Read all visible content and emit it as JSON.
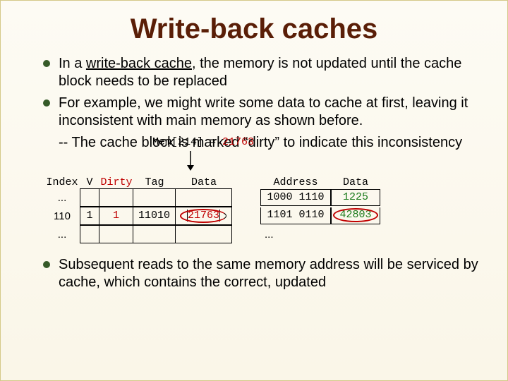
{
  "title": "Write-back caches",
  "bullets": {
    "b1_a": "In a ",
    "b1_underline": "write-back cache",
    "b1_b": ", the memory is not updated until the cache block needs to be replaced",
    "b2": "For example, we might write some data to cache at first, leaving it inconsistent with main memory as shown before.",
    "b2_sub": "-- The cache block is marked “dirty” to indicate this inconsistency",
    "b3": "Subsequent reads to the same memory address will be serviced by cache, which contains the correct, updated"
  },
  "mem_expr_lhs": "Mem[214] = ",
  "mem_expr_rhs": "21763",
  "cache": {
    "headers": {
      "index": "Index",
      "v": "V",
      "dirty": "Dirty",
      "tag": "Tag",
      "data": "Data"
    },
    "rows": {
      "r0": {
        "index": "..."
      },
      "r1": {
        "index": "110",
        "v": "1",
        "dirty": "1",
        "tag": "11010",
        "data": "21763"
      },
      "r2": {
        "index": "..."
      }
    }
  },
  "memory": {
    "headers": {
      "addr": "Address",
      "data": "Data"
    },
    "rows": {
      "r0": {
        "addr": "1000 1110",
        "data": "1225"
      },
      "r1": {
        "addr": "1101 0110",
        "data": "42803"
      },
      "r2": {
        "addr": "..."
      }
    }
  }
}
